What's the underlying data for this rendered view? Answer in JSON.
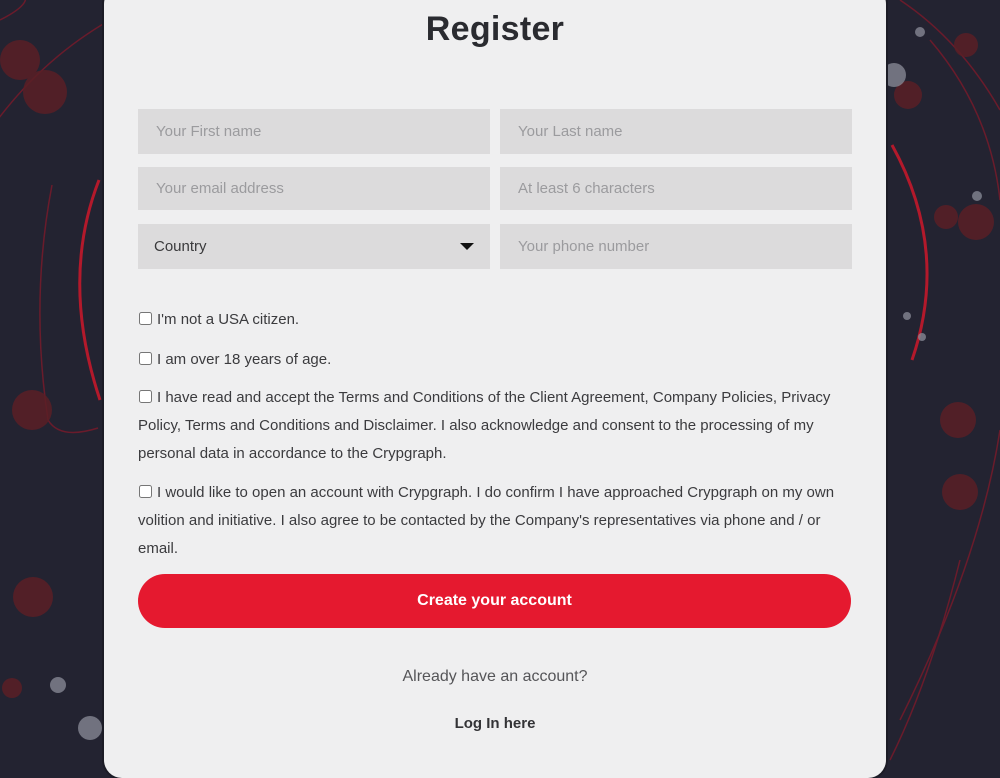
{
  "colors": {
    "background": "#232331",
    "card": "#efeff0",
    "field": "#dcdbdc",
    "accent": "#e5192f",
    "decor_red": "#b3192b",
    "decor_dot": "#8b8d99"
  },
  "form": {
    "title": "Register",
    "fields": {
      "first_name": {
        "placeholder": "Your First name",
        "value": ""
      },
      "last_name": {
        "placeholder": "Your Last name",
        "value": ""
      },
      "email": {
        "placeholder": "Your email address",
        "value": ""
      },
      "password": {
        "placeholder": "At least 6 characters",
        "value": ""
      },
      "country": {
        "selected": "Country",
        "icon": "caret-down-icon"
      },
      "phone": {
        "placeholder": "Your phone number",
        "value": ""
      }
    },
    "checkboxes": [
      {
        "label": "I'm not a USA citizen.",
        "checked": false
      },
      {
        "label": "I am over 18 years of age.",
        "checked": false
      },
      {
        "label": "I have read and accept the Terms and Conditions of the Client Agreement, Company Policies, Privacy Policy, Terms and Conditions and Disclaimer. I also acknowledge and consent to the processing of my personal data in accordance to the Crypgraph.",
        "checked": false
      },
      {
        "label": "I would like to open an account with Crypgraph. I do confirm I have approached Crypgraph on my own volition and initiative. I also agree to be contacted by the Company's representatives via phone and / or email.",
        "checked": false
      }
    ],
    "submit_label": "Create your account",
    "already_text": "Already have an account?",
    "login_link": "Log In here"
  }
}
